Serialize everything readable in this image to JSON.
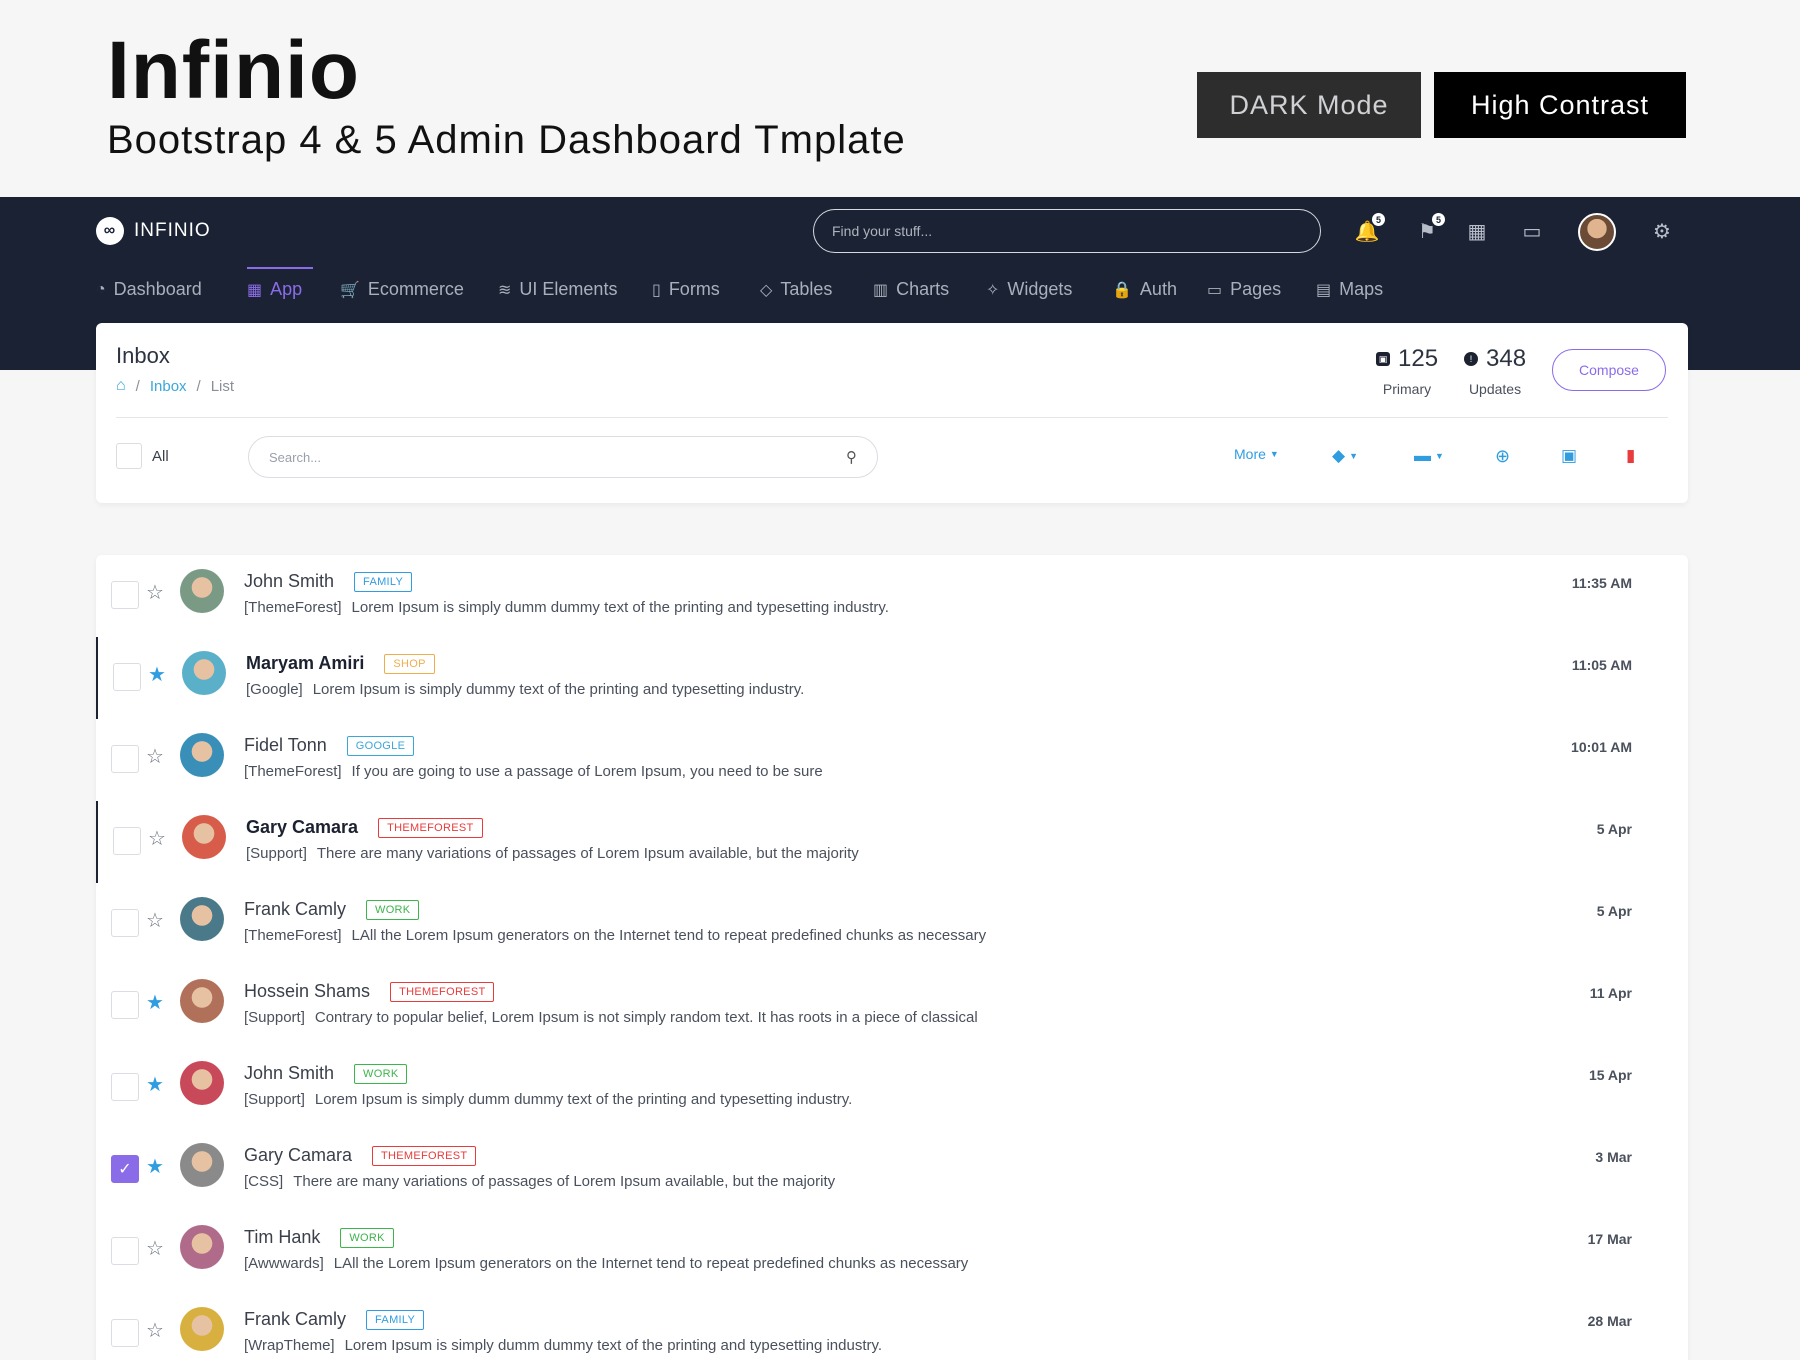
{
  "promo": {
    "title": "Infinio",
    "subtitle": "Bootstrap 4 & 5  Admin Dashboard Tmplate",
    "dark_mode_label": "DARK Mode",
    "high_contrast_label": "High Contrast"
  },
  "topbar": {
    "brand": "INFINIO",
    "search_placeholder": "Find your stuff...",
    "notifications_count": "5",
    "flags_count": "5"
  },
  "nav": [
    {
      "label": "Dashboard",
      "icon": "◔"
    },
    {
      "label": "App",
      "icon": "▦"
    },
    {
      "label": "Ecommerce",
      "icon": "🛒"
    },
    {
      "label": "UI Elements",
      "icon": "≋"
    },
    {
      "label": "Forms",
      "icon": "▯"
    },
    {
      "label": "Tables",
      "icon": "◇"
    },
    {
      "label": "Charts",
      "icon": "▥"
    },
    {
      "label": "Widgets",
      "icon": "✧"
    },
    {
      "label": "Auth",
      "icon": "🔒"
    },
    {
      "label": "Pages",
      "icon": "▭"
    },
    {
      "label": "Maps",
      "icon": "▤"
    }
  ],
  "inbox": {
    "title": "Inbox",
    "breadcrumb": {
      "link": "Inbox",
      "current": "List"
    },
    "primary": {
      "count": "125",
      "label": "Primary"
    },
    "updates": {
      "count": "348",
      "label": "Updates"
    },
    "compose_label": "Compose",
    "all_label": "All",
    "search_placeholder": "Search...",
    "more_label": "More"
  },
  "emails": [
    {
      "name": "John Smith",
      "tag": "FAMILY",
      "source": "[ThemeForest]",
      "text": "Lorem Ipsum is simply dumm dummy text of the printing and typesetting industry.",
      "time": "11:35 AM",
      "starred": false,
      "checked": false,
      "bold": false
    },
    {
      "name": "Maryam Amiri",
      "tag": "SHOP",
      "source": "[Google]",
      "text": "Lorem Ipsum is simply dummy text of the printing and typesetting industry.",
      "time": "11:05 AM",
      "starred": true,
      "checked": false,
      "bold": true
    },
    {
      "name": "Fidel Tonn",
      "tag": "GOOGLE",
      "source": "[ThemeForest]",
      "text": "If you are going to use a passage of Lorem Ipsum, you need to be sure",
      "time": "10:01 AM",
      "starred": false,
      "checked": false,
      "bold": false
    },
    {
      "name": "Gary Camara",
      "tag": "THEMEFOREST",
      "source": "[Support]",
      "text": "There are many variations of passages of Lorem Ipsum available, but the majority",
      "time": "5 Apr",
      "starred": false,
      "checked": false,
      "bold": true
    },
    {
      "name": "Frank Camly",
      "tag": "WORK",
      "source": "[ThemeForest]",
      "text": "LAll the Lorem Ipsum generators on the Internet tend to repeat predefined chunks as necessary",
      "time": "5 Apr",
      "starred": false,
      "checked": false,
      "bold": false
    },
    {
      "name": "Hossein Shams",
      "tag": "THEMEFOREST",
      "source": "[Support]",
      "text": "Contrary to popular belief, Lorem Ipsum is not simply random text. It has roots in a piece of classical",
      "time": "11 Apr",
      "starred": true,
      "checked": false,
      "bold": false
    },
    {
      "name": "John Smith",
      "tag": "WORK",
      "source": "[Support]",
      "text": "Lorem Ipsum is simply dumm dummy text of the printing and typesetting industry.",
      "time": "15 Apr",
      "starred": true,
      "checked": false,
      "bold": false
    },
    {
      "name": "Gary Camara",
      "tag": "THEMEFOREST",
      "source": "[CSS]",
      "text": "There are many variations of passages of Lorem Ipsum available, but the majority",
      "time": "3 Mar",
      "starred": true,
      "checked": true,
      "bold": false
    },
    {
      "name": "Tim Hank",
      "tag": "WORK",
      "source": "[Awwwards]",
      "text": "LAll the Lorem Ipsum generators on the Internet tend to repeat predefined chunks as necessary",
      "time": "17 Mar",
      "starred": false,
      "checked": false,
      "bold": false
    },
    {
      "name": "Frank Camly",
      "tag": "FAMILY",
      "source": "[WrapTheme]",
      "text": "Lorem Ipsum is simply dumm dummy text of the printing and typesetting industry.",
      "time": "28 Mar",
      "starred": false,
      "checked": false,
      "bold": false
    }
  ],
  "tag_colors": {
    "FAMILY": "#2f9de0",
    "SHOP": "#f0ad4e",
    "GOOGLE": "#3aa7d9",
    "THEMEFOREST": "#e83b3b",
    "WORK": "#3cb54a"
  },
  "colors": {
    "accent": "#8b6ce8",
    "navbar": "#1a2234",
    "link": "#2f9de0",
    "danger": "#e83b3b"
  }
}
